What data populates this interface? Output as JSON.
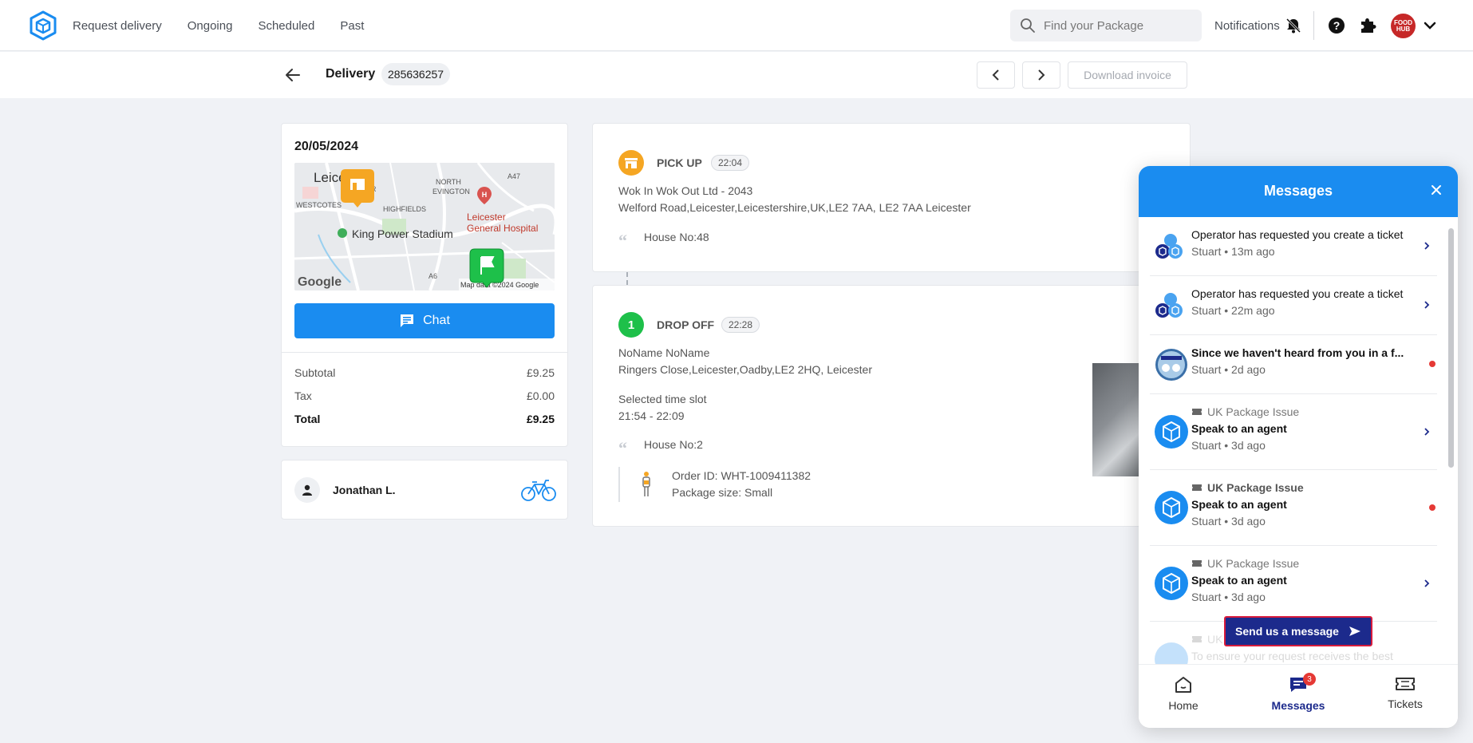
{
  "nav": {
    "links": [
      "Request delivery",
      "Ongoing",
      "Scheduled",
      "Past"
    ],
    "search_placeholder": "Find your Package",
    "notifications_label": "Notifications",
    "avatar_text": "FOOD HUB"
  },
  "subheader": {
    "title": "Delivery",
    "delivery_id": "285636257",
    "download_label": "Download invoice"
  },
  "order": {
    "date": "20/05/2024",
    "map_labels": {
      "leicester": "Leice",
      "north_evington": "NORTH\nEVINGTON",
      "westcotes": "WESTCOTES",
      "highfields": "HIGHFIELDS",
      "stadium": "King Power Stadium",
      "hospital": "Leicester\nGeneral Hospital",
      "a47": "A47",
      "a6": "A6",
      "google": "Google",
      "map_data": "Map data ©2024 Google",
      "ctr": "CTR"
    },
    "chat_label": "Chat",
    "summary": [
      {
        "label": "Subtotal",
        "value": "£9.25"
      },
      {
        "label": "Tax",
        "value": "£0.00"
      },
      {
        "label": "Total",
        "value": "£9.25"
      }
    ],
    "courier_name": "Jonathan L."
  },
  "pickup": {
    "title": "PICK UP",
    "time": "22:04",
    "name": "Wok In Wok Out Ltd - 2043",
    "address": "Welford Road,Leicester,Leicestershire,UK,LE2 7AA, LE2 7AA Leicester",
    "note": "House No:48"
  },
  "dropoff": {
    "step": "1",
    "title": "DROP OFF",
    "time": "22:28",
    "name": "NoName NoName",
    "address": "Ringers Close,Leicester,Oadby,LE2 2HQ, Leicester",
    "slot_label": "Selected time slot",
    "slot_value": "21:54 - 22:09",
    "note": "House No:2",
    "order_id": "Order ID: WHT-1009411382",
    "package_size": "Package size: Small"
  },
  "messages": {
    "title": "Messages",
    "items": [
      {
        "text": "Operator has requested you create a ticket",
        "meta": "Stuart • 13m ago"
      },
      {
        "text": "Operator has requested you create a ticket",
        "meta": "Stuart • 22m ago"
      },
      {
        "text": "Since we haven't heard from you in a f...",
        "meta": "Stuart • 2d ago"
      },
      {
        "category": "UK Package Issue",
        "text": "Speak to an agent",
        "meta": "Stuart • 3d ago"
      },
      {
        "category": "UK Package Issue",
        "text": "Speak to an agent",
        "meta": "Stuart • 3d ago"
      },
      {
        "category": "UK Package Issue",
        "text": "Speak to an agent",
        "meta": "Stuart • 3d ago"
      },
      {
        "category": "UK",
        "text": "To ensure your request receives the best"
      }
    ],
    "send_label": "Send us a message",
    "tabs": [
      "Home",
      "Messages",
      "Tickets"
    ],
    "messages_badge": "3"
  },
  "colors": {
    "primary": "#1a8cf0",
    "navy": "#1c2a8c",
    "pickup_icon": "#f5a623",
    "dropoff_icon": "#1ec04a",
    "unread_dot": "#e53935"
  }
}
